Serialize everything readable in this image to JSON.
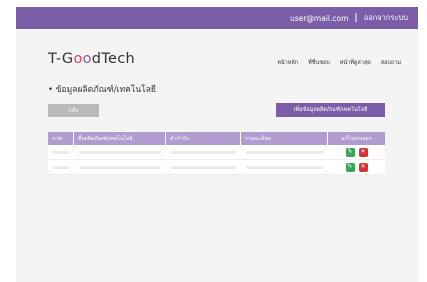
{
  "topbar": {
    "user_email": "user@mail.com",
    "separator": "|",
    "logout_label": "ออกจากระบบ"
  },
  "brand": {
    "part1": "T-G",
    "o1": "o",
    "o2": "o",
    "part2": "dTech"
  },
  "nav": {
    "items": [
      "หน้าหลัก",
      "ที่ชื่นชอบ",
      "หน้าที่ดูล่าสุด",
      "สอบถาม"
    ]
  },
  "page": {
    "heading": "• ข้อมูลผลิตภัณฑ์/เทคโนโลยี"
  },
  "actions": {
    "back_label": "กลับ",
    "add_label": "เพิ่มข้อมูลผลิตภัณฑ์/เทคโนโลยี"
  },
  "table": {
    "headers": [
      "ภาพ",
      "ชื่อผลิตภัณฑ์/เทคโนโลยี",
      "คำกำกับ",
      "รายละเอียด",
      "แก้ไข/ลบออก"
    ],
    "row_count": 2
  },
  "icons": {
    "edit": "pencil-icon",
    "delete": "x-icon"
  },
  "colors": {
    "accent": "#7b5ea7",
    "header": "#b09ccf",
    "edit": "#3aa655",
    "delete": "#d93030",
    "logo_o1": "#e04848"
  }
}
